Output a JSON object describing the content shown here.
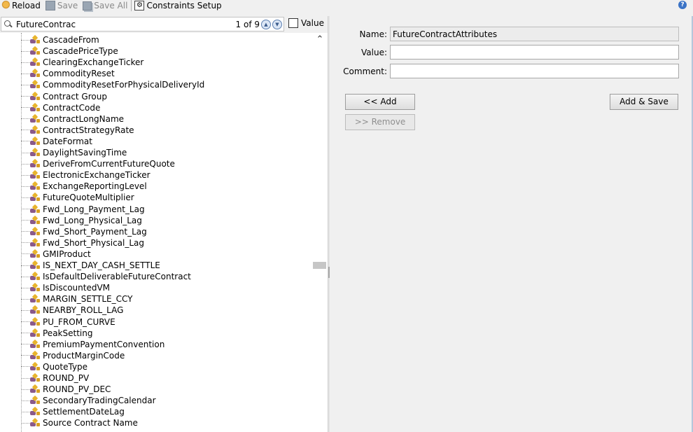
{
  "toolbar": {
    "reload": "Reload",
    "save": "Save",
    "save_all": "Save All",
    "constraints": "Constraints Setup",
    "help": "?"
  },
  "search": {
    "value": "FutureContrac",
    "match_count": "1 of 9",
    "value_checkbox_label": "Value",
    "value_checked": false
  },
  "tree": {
    "items": [
      "CascadeFrom",
      "CascadePriceType",
      "ClearingExchangeTicker",
      "CommodityReset",
      "CommodityResetForPhysicalDeliveryId",
      "Contract Group",
      "ContractCode",
      "ContractLongName",
      "ContractStrategyRate",
      "DateFormat",
      "DaylightSavingTime",
      "DeriveFromCurrentFutureQuote",
      "ElectronicExchangeTicker",
      "ExchangeReportingLevel",
      "FutureQuoteMultiplier",
      "Fwd_Long_Payment_Lag",
      "Fwd_Long_Physical_Lag",
      "Fwd_Short_Payment_Lag",
      "Fwd_Short_Physical_Lag",
      "GMIProduct",
      "IS_NEXT_DAY_CASH_SETTLE",
      "IsDefaultDeliverableFutureContract",
      "IsDiscountedVM",
      "MARGIN_SETTLE_CCY",
      "NEARBY_ROLL_LAG",
      "PU_FROM_CURVE",
      "PeakSetting",
      "PremiumPaymentConvention",
      "ProductMarginCode",
      "QuoteType",
      "ROUND_PV",
      "ROUND_PV_DEC",
      "SecondaryTradingCalendar",
      "SettlementDateLag",
      "Source Contract Name"
    ]
  },
  "form": {
    "name_label": "Name:",
    "name_value": "FutureContractAttributes",
    "value_label": "Value:",
    "value_value": "",
    "comment_label": "Comment:",
    "comment_value": "",
    "add_button": "<< Add",
    "add_save_button": "Add & Save",
    "remove_button": ">> Remove"
  }
}
